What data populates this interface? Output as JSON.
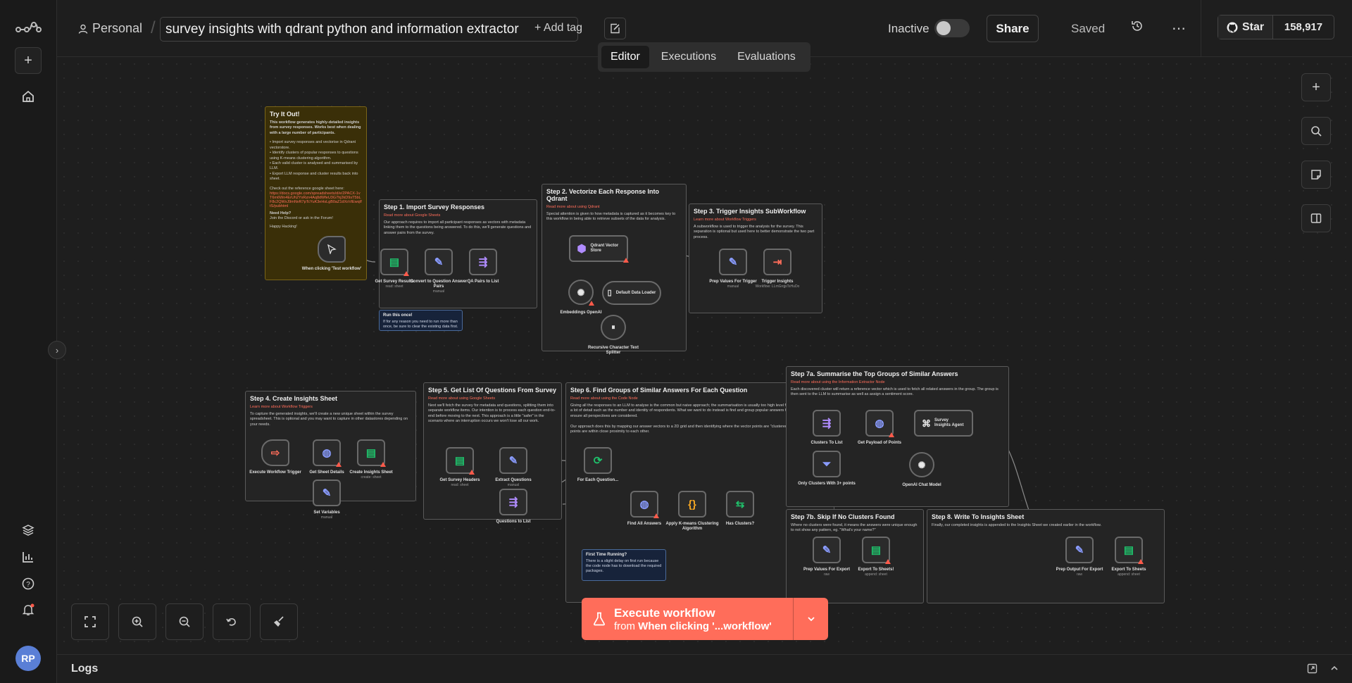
{
  "header": {
    "project": "Personal",
    "workflow_name": "survey insights with qdrant python and information extractor",
    "add_tag": "+ Add tag",
    "status_label": "Inactive",
    "share": "Share",
    "saved": "Saved",
    "github_star": "Star",
    "github_count": "158,917"
  },
  "tabs": [
    "Editor",
    "Executions",
    "Evaluations"
  ],
  "active_tab": "Editor",
  "colors": {
    "accent": "#ff6d5a",
    "node_border": "#6a6a6a",
    "canvas": "#1e1e1e",
    "sticky_yellow": "#3a2f08"
  },
  "stickies": {
    "try": {
      "title": "Try It Out!",
      "intro": "This workflow generates highly-detailed insights from survey responses. Works best when dealing with a large number of participants.",
      "bullets": "• Import survey responses and vectorise in Qdrant vectorstore.\n• Identify clusters of popular responses to questions using K-means clustering algorithm.\n• Each valid cluster is analysed and summarised by LLM.\n• Export LLM response and cluster results back into sheet.",
      "ref": "Check out the reference google sheet here:",
      "ref_link": "https://docs.google.com/spreadsheets/d/e/2PACX-1vT6m6Wn4ErUh2YxRzn4Aq8dWfeU3G7hj2kD9sT5bLF8c2QWxJ9mNvR7pTcYuK3eHsLgB0aZ1dXoViEwqIftS/pubhtml",
      "help_title": "Need Help?",
      "help": "Join the Discord or ask in the Forum!",
      "happy": "Happy Hacking!"
    },
    "s1": {
      "title": "Step 1. Import Survey Responses",
      "link": "Read more about Google Sheets",
      "text": "Our approach requires to import all participant responses as vectors with metadata linking them to the questions being answered. To do this, we'll generate questions and answer pairs from the survey."
    },
    "s2": {
      "title": "Step 2. Vectorize Each Response Into Qdrant",
      "link": "Read more about using Qdrant",
      "text": "Special attention is given to how metadata is captured as it becomes key to this workflow in being able to retrieve subsets of the data for analysis."
    },
    "s3": {
      "title": "Step 3. Trigger Insights SubWorkflow",
      "link": "Learn more about Workflow Triggers",
      "text": "A subworkflow is used to trigger the analysis for the survey. This separation is optional but used here to better demonstrate the two part process."
    },
    "s4": {
      "title": "Step 4. Create Insights Sheet",
      "link": "Learn more about Workflow Triggers",
      "text": "To capture the generated insights, we'll create a new unique sheet within the survey spreadsheet. This is optional and you may want to capture in other datastores depending on your needs."
    },
    "s5": {
      "title": "Step 5. Get List Of Questions From Survey",
      "link": "Read more about using Google Sheets",
      "text": "Next we'll fetch the survey for metadata and questions, splitting them into separate workflow items. Our intention is to process each question end-to-end before moving to the next. This approach is a little \"safer\" in the scenario where an interruption occurs we won't lose all our work."
    },
    "s6": {
      "title": "Step 6. Find Groups of Similar Answers For Each Question",
      "link": "Read more about using the Code Node",
      "text": "Giving all the responses to an LLM to analyse is the common but naive approach; the summarisation is usually too high level for real insights and loses a lot of detail such as the number and identity of respondents. What we want to do instead is find and group popular answers for each question to ensure all perspectives are considered.\n\nOur approach does this by mapping our answer vectors to a 2D grid and then identifying where the vector points are \"clustered\"; where a group of points are within close proximity to each other."
    },
    "s7a": {
      "title": "Step 7a. Summarise the Top Groups of Similar Answers",
      "link": "Read more about using the Information Extractor Node",
      "text": "Each discovered cluster will return a reference vector which is used to fetch all related answers in the group. The group is then sent to the LLM to summarise as well as assign a sentiment score."
    },
    "s7b": {
      "title": "Step 7b. Skip If No Clusters Found",
      "text": "Where no clusters were found, it means the answers were unique enough to not show any pattern, eg. \"What's your name?\""
    },
    "s8": {
      "title": "Step 8. Write To Insights Sheet",
      "text": "Finally, our completed insights is appended to the Insights Sheet we created earlier in the workflow."
    },
    "run_once": {
      "title": "Run this once!",
      "text": "If for any reason you need to run more than once, be sure to clear the existing data first."
    },
    "first_time": {
      "title": "First Time Running?",
      "text": "There is a slight delay on first run because the code node has to download the required packages."
    }
  },
  "nodes": {
    "trigger": {
      "label": "When clicking 'Test workflow'",
      "icon": "pointer-icon"
    },
    "get_survey": {
      "label": "Get Survey Results",
      "sub": "read: sheet",
      "icon": "google-sheets-icon"
    },
    "convert_qa": {
      "label": "Convert to Question Answer Pairs",
      "sub": "manual",
      "icon": "edit-fields-icon"
    },
    "qa_list": {
      "label": "QA Pairs to List",
      "icon": "split-out-icon"
    },
    "qdrant": {
      "label": "Qdrant Vector Store",
      "icon": "qdrant-icon"
    },
    "embeddings": {
      "label": "Embeddings OpenAI",
      "icon": "openai-icon"
    },
    "loader": {
      "label": "Default Data Loader",
      "icon": "document-icon"
    },
    "splitter": {
      "label": "Recursive Character Text Splitter",
      "icon": "text-splitter-icon"
    },
    "prep_trigger": {
      "label": "Prep Values For Trigger",
      "sub": "manual",
      "icon": "edit-fields-icon"
    },
    "trigger_insights": {
      "label": "Trigger Insights",
      "sub": "Workflow: LLmGrqjsTsHuDo",
      "icon": "execute-workflow-icon"
    },
    "exec_trigger": {
      "label": "Execute Workflow Trigger",
      "icon": "sign-in-icon"
    },
    "get_sheet_details": {
      "label": "Get Sheet Details",
      "icon": "globe-icon"
    },
    "create_insights": {
      "label": "Create Insights Sheet",
      "sub": "create: sheet",
      "icon": "google-sheets-icon"
    },
    "set_vars": {
      "label": "Set Variables",
      "sub": "manual",
      "icon": "edit-fields-icon"
    },
    "survey_headers": {
      "label": "Get Survey Headers",
      "sub": "read: sheet",
      "icon": "google-sheets-icon"
    },
    "extract_q": {
      "label": "Extract Questions",
      "sub": "manual",
      "icon": "edit-fields-icon"
    },
    "q_list": {
      "label": "Questions to List",
      "icon": "split-out-icon"
    },
    "for_each": {
      "label": "For Each Question...",
      "icon": "loop-icon"
    },
    "find_all": {
      "label": "Find All Answers",
      "icon": "globe-icon"
    },
    "kmeans": {
      "label": "Apply K-means Clustering Algorithm",
      "icon": "code-icon"
    },
    "has_clusters": {
      "label": "Has Clusters?",
      "icon": "if-icon"
    },
    "clusters_list": {
      "label": "Clusters To List",
      "icon": "split-out-icon"
    },
    "only_clusters": {
      "label": "Only Clusters With 3+ points",
      "icon": "filter-icon"
    },
    "payload": {
      "label": "Get Payload of Points",
      "icon": "globe-icon"
    },
    "agent": {
      "label": "Survey Insights Agent",
      "icon": "agent-icon"
    },
    "chat_model": {
      "label": "OpenAI Chat Model",
      "icon": "openai-icon"
    },
    "prep_export": {
      "label": "Prep Values For Export",
      "sub": "raw",
      "icon": "edit-fields-icon"
    },
    "export_sheets": {
      "label": "Export To Sheets!",
      "sub": "append: sheet",
      "icon": "google-sheets-icon"
    },
    "prep_output": {
      "label": "Prep Output For Export",
      "sub": "raw",
      "icon": "edit-fields-icon"
    },
    "export_sheets2": {
      "label": "Export To Sheets",
      "sub": "append: sheet",
      "icon": "google-sheets-icon"
    }
  },
  "execute": {
    "title": "Execute workflow",
    "from": "from",
    "trigger": "When clicking '...workflow'"
  },
  "logs": "Logs",
  "avatar": "RP"
}
